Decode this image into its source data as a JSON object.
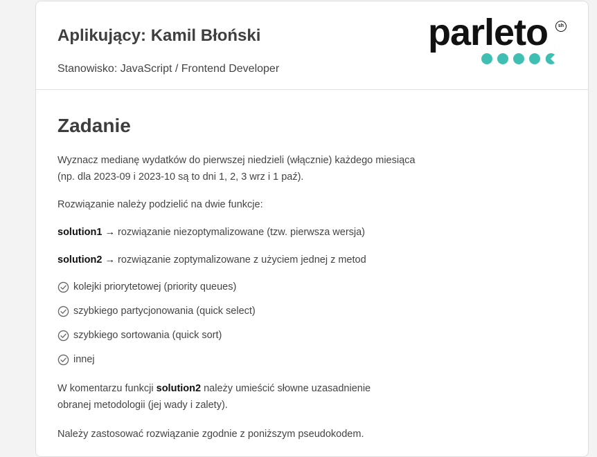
{
  "header": {
    "applicant": "Aplikujący: Kamil Błoński",
    "position": "Stanowisko: JavaScript / Frontend Developer",
    "logo_text": "parleto",
    "logo_badge": "sh",
    "logo_color": "#111111",
    "dots_color": "#3fbfb2"
  },
  "task": {
    "title": "Zadanie",
    "intro_line1": "Wyznacz medianę wydatków do pierwszej niedzieli (włącznie) każdego miesiąca",
    "intro_line2": "(np. dla 2023-09 i 2023-10 są to dni 1, 2, 3 wrz i 1 paź).",
    "split": "Rozwiązanie należy podzielić na dwie funkcje:",
    "solution1_name": "solution1 →",
    "solution1_desc": " rozwiązanie niezoptymalizowane (tzw. pierwsza wersja)",
    "solution2_name": "solution2 →",
    "solution2_desc": " rozwiązanie zoptymalizowane z użyciem jednej z metod",
    "methods": [
      "kolejki priorytetowej (priority queues)",
      "szybkiego partycjonowania (quick select)",
      "szybkiego sortowania (quick sort)",
      "innej"
    ],
    "comment_pre": "W komentarzu funkcji ",
    "comment_bold": "solution2",
    "comment_post": " należy umieścić słowne uzasadnienie",
    "comment_line2": "obranej metodologii (jej wady i zalety).",
    "pseudo": "Należy zastosować rozwiązanie zgodnie z poniższym pseudokodem."
  }
}
